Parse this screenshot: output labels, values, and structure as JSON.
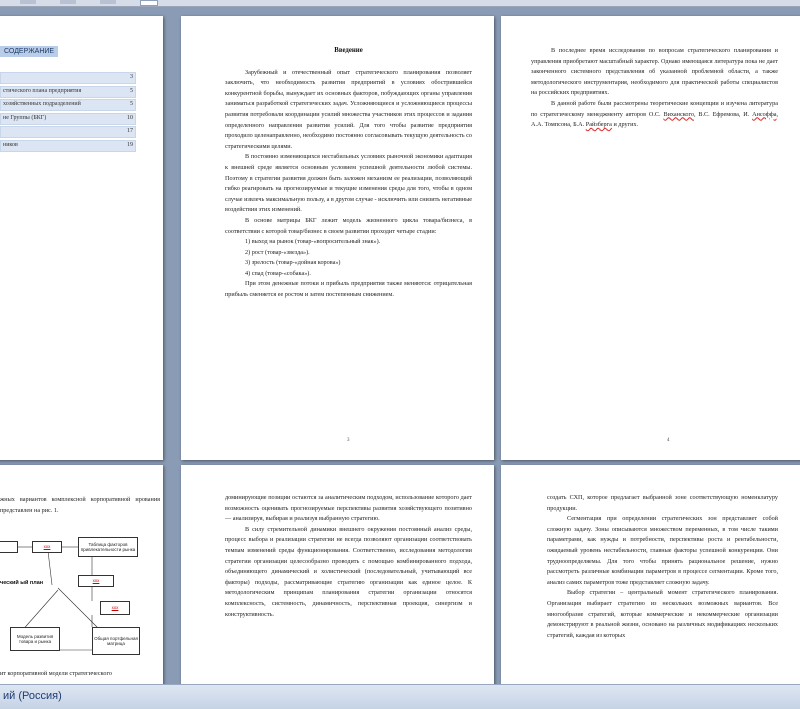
{
  "toc": {
    "heading": "СОДЕРЖАНИЕ",
    "rows": [
      {
        "label": "",
        "page": "3"
      },
      {
        "label": "стического плана предприятия",
        "page": "5"
      },
      {
        "label": "хозяйственных подразделений",
        "page": "5"
      },
      {
        "label": "не Группы (БКГ)",
        "page": "10"
      },
      {
        "label": "",
        "page": "17"
      },
      {
        "label": "ников",
        "page": "19"
      }
    ]
  },
  "intro": {
    "title": "Введение",
    "p1": "Зарубежный и отечественный опыт стратегического планирования позволяет заключить, что необходимость развития предприятий в условиях обострившейся конкурентной борьбы, вынуждает их основных факторов, побуждающих органы управления заниматься разработкой стратегических задач. Усложняющиеся и усложняющиеся процессы развития потребовали координации усилий множества участников этих процессов и задания определенного направления развития усилий. Для того чтобы развитие предприятия проходило целенаправленно, необходимо постоянно согласовывать текущую деятельность со стратегическими целями.",
    "p2": "В постоянно изменяющихся нестабильных условиях рыночной экономики адаптация к внешней среде является основным условием успешной деятельности любой системы. Поэтому в стратегии развития должен быть заложен механизм ее реализации, позволяющий гибко реагировать на прогнозируемые и текущие изменения среды для того, чтобы в одном случае извлечь максимальную пользу, а в другом случае - исключить или снизить негативные воздействия этих изменений.",
    "p3": "В основе матрицы БКГ лежит модель жизненного цикла товара/бизнеса, в соответствии с которой товар/бизнес в своем развитии проходит четыре стадии:",
    "items": [
      "1) выход на рынок (товар-«вопросительный знак»).",
      "2) рост (товар-«звезда»).",
      "3) зрелость (товар-«дойная корова»)",
      "4) спад (товар-«собака»)."
    ],
    "p4": "При этом денежные потоки и прибыль предприятия также меняются: отрицательная прибыль сменяется ее ростом и затем постепенным снижением.",
    "page_num": "3"
  },
  "right_page": {
    "p1": "В последнее время исследования по вопросам стратегического планирования и управления приобретают масштабный характер. Однако имеющаяся литература пока не дает законченного системного представления об указанной проблемной области, а также методологического инструментария, необходимого для практической работы специалистов на российских предприятиях.",
    "p2_start": "В данной работе были рассмотрены теоретические концепции и изучена литература по стратегическому менеджменту авторов О.С. ",
    "author1": "Виханского",
    "p2_mid1": ", В.С. Ефремова, И. ",
    "author2": "Ансоффа",
    "p2_mid2": ", А.А. Томпсона, Б.А. ",
    "author3": "Райзберга",
    "p2_end": " и других.",
    "page_num": "4"
  },
  "bottom_left": {
    "text_top": "жных вариантов комплексной корпоративной ирования представлен на рис. 1.",
    "box_a": "",
    "box_b": "Таблица факторов привлекательности рынка",
    "bold_label": "ческий ый план",
    "box_model": "Модель развития товара и рынка",
    "box_matrix": "Общая портфельная матрица",
    "red1": "ххх",
    "red2": "ххх",
    "red3": "ххх",
    "text_bottom": "ит корпоративной модели стратегического"
  },
  "bottom_mid": {
    "text": "доминирующие позиции остаются за аналитическим подходом, использование которого дает возможность оценивать прогнозируемые перспективы развития хозяйствующего позитивно — анализируя, выбирая и реализуя выбранную стратегию.",
    "text2": "В силу стремительной динамики внешнего окружения постоянный анализ среды, процесс выбора и реализации стратегии не всегда позволяют организации соответствовать темпам изменений среды функционирования. Соответственно, исследования методологии стратегии организации целесообразно проводить с помощью комбинированного подхода, объединяющего динамический и холистический (последовательный, учитывающий все факторы) подходы, рассматривающие стратегию организации как единое целое. К методологическим принципам планирования стратегии организации относятся комплексность, системность, динамичность, перспективная проекция, синергизм и конструктивность."
  },
  "bottom_right": {
    "text": "создать СХП, которое предлагает выбранной зоне соответствующую номенклатуру продукции.",
    "text2": "Сегментация при определении стратегических зон представляет собой сложную задачу. Зоны описываются множеством переменных, в том числе такими параметрами, как нужды и потребности, перспективы роста и рентабельности, ожидаемый уровень нестабильности, главные факторы успешной конкуренции. Они трудноопределяемы. Для того чтобы принять рациональное решение, нужно рассмотреть различные комбинации параметров в процессе сегментации. Кроме того, анализ самих параметров тоже представляет сложную задачу.",
    "text3": "Выбор стратегии – центральный момент стратегического планирования. Организация выбирает стратегию из нескольких возможных вариантов. Все многообразие стратегий, которые коммерческие и некоммерческие организации демонстрируют в реальной жизни, основано на различных модификациях нескольких стратегий, каждая из которых"
  },
  "status": {
    "language": "ий (Россия)"
  }
}
